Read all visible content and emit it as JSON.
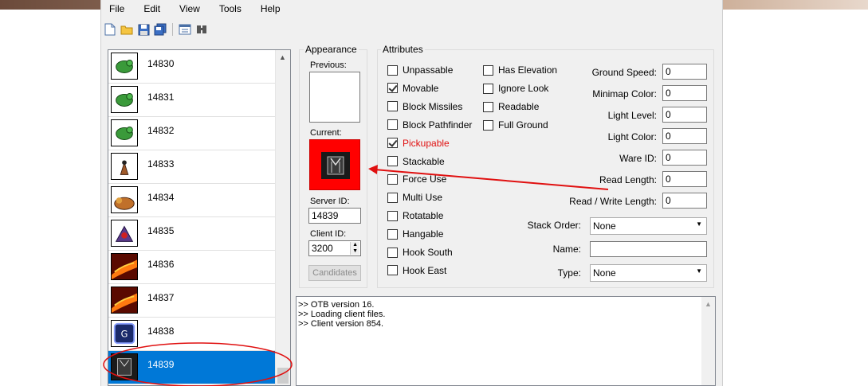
{
  "menu": [
    "File",
    "Edit",
    "View",
    "Tools",
    "Help"
  ],
  "toolbar": [
    "new-file-icon",
    "open-folder-icon",
    "save-icon",
    "save-as-icon",
    "preferences-icon",
    "compare-icon"
  ],
  "items": [
    {
      "id": "14830",
      "icon": "green-creature-icon"
    },
    {
      "id": "14831",
      "icon": "green-creature-icon"
    },
    {
      "id": "14832",
      "icon": "green-creature-icon"
    },
    {
      "id": "14833",
      "icon": "small-creature-icon"
    },
    {
      "id": "14834",
      "icon": "creature-icon"
    },
    {
      "id": "14835",
      "icon": "purple-creature-icon"
    },
    {
      "id": "14836",
      "icon": "fire-icon"
    },
    {
      "id": "14837",
      "icon": "fire-icon"
    },
    {
      "id": "14838",
      "icon": "blue-rune-icon"
    },
    {
      "id": "14839",
      "icon": "dark-item-icon"
    }
  ],
  "selected_item": "14839",
  "appearance": {
    "title": "Appearance",
    "previous_label": "Previous:",
    "current_label": "Current:",
    "current_bg": "#ff0000",
    "server_id_label": "Server ID:",
    "server_id": "14839",
    "client_id_label": "Client ID:",
    "client_id": "3200",
    "candidates_label": "Candidates"
  },
  "attributes": {
    "title": "Attributes",
    "col1": [
      {
        "label": "Unpassable",
        "checked": false
      },
      {
        "label": "Movable",
        "checked": true
      },
      {
        "label": "Block Missiles",
        "checked": false
      },
      {
        "label": "Block Pathfinder",
        "checked": false
      },
      {
        "label": "Pickupable",
        "checked": true,
        "highlight": true
      },
      {
        "label": "Stackable",
        "checked": false
      },
      {
        "label": "Force Use",
        "checked": false
      },
      {
        "label": "Multi Use",
        "checked": false
      },
      {
        "label": "Rotatable",
        "checked": false
      },
      {
        "label": "Hangable",
        "checked": false
      },
      {
        "label": "Hook South",
        "checked": false
      },
      {
        "label": "Hook East",
        "checked": false
      }
    ],
    "col2": [
      {
        "label": "Has Elevation",
        "checked": false
      },
      {
        "label": "Ignore Look",
        "checked": false
      },
      {
        "label": "Readable",
        "checked": false
      },
      {
        "label": "Full Ground",
        "checked": false
      }
    ],
    "fields": [
      {
        "label": "Ground Speed:",
        "value": "0"
      },
      {
        "label": "Minimap Color:",
        "value": "0"
      },
      {
        "label": "Light Level:",
        "value": "0"
      },
      {
        "label": "Light Color:",
        "value": "0"
      },
      {
        "label": "Ware ID:",
        "value": "0"
      },
      {
        "label": "Read Length:",
        "value": "0"
      },
      {
        "label": "Read / Write Length:",
        "value": "0"
      }
    ],
    "stack_order_label": "Stack Order:",
    "stack_order": "None",
    "name_label": "Name:",
    "name": "",
    "type_label": "Type:",
    "type": "None"
  },
  "log": [
    ">> OTB version 16.",
    ">> Loading client files.",
    ">> Client version 854."
  ],
  "colors": {
    "selection": "#0078d7",
    "annotation": "#e01010"
  }
}
